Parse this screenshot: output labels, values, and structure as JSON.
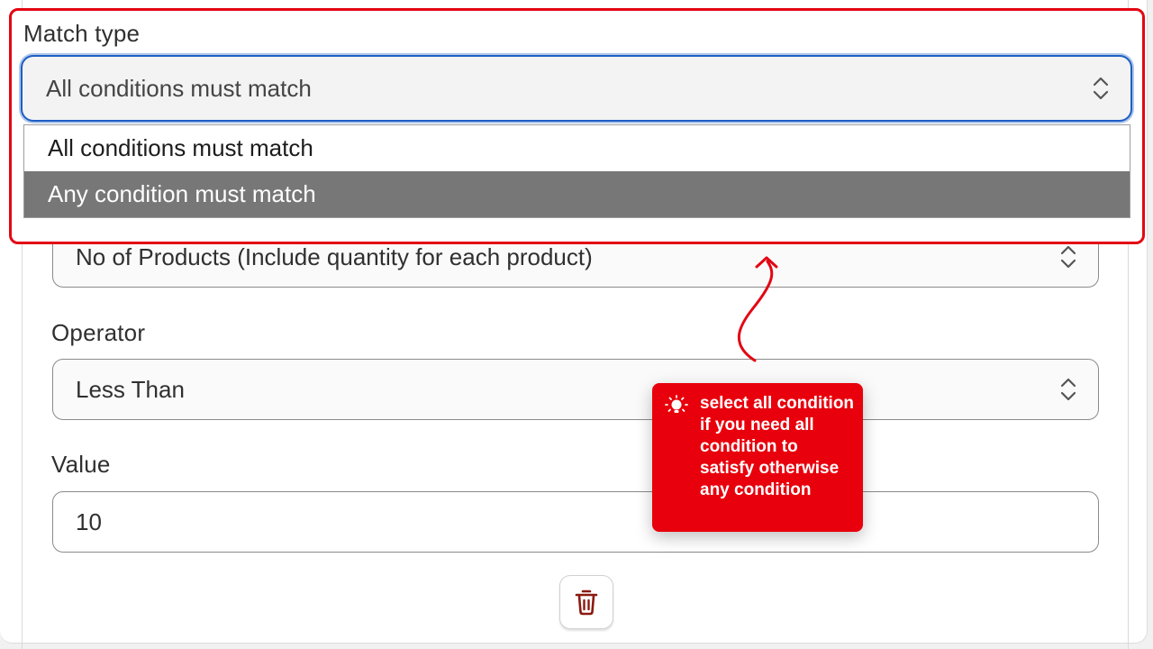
{
  "match_type": {
    "label": "Match type",
    "selected": "All conditions must match",
    "options": [
      {
        "label": "All conditions must match",
        "highlighted": false
      },
      {
        "label": "Any condition must match",
        "highlighted": true
      }
    ]
  },
  "condition": {
    "type_value": "No of Products (Include quantity for each product)",
    "operator_label": "Operator",
    "operator_value": "Less Than",
    "value_label": "Value",
    "value": "10"
  },
  "tooltip": {
    "text": "select all condition if you need all condition to satisfy otherwise any condition",
    "icon": "lightbulb-icon"
  },
  "colors": {
    "highlight": "#e30613",
    "focus_ring": "#1d5fc4",
    "tooltip_bg": "#e8000c",
    "delete_icon": "#8b1a10"
  }
}
